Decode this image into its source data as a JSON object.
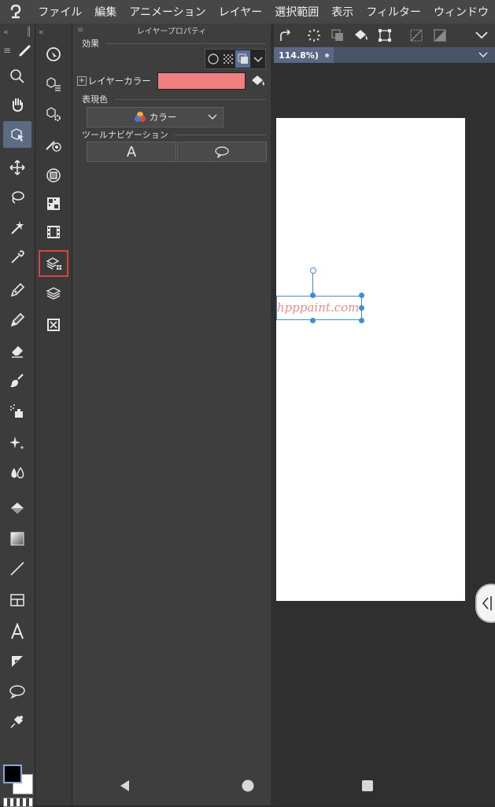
{
  "menu": {
    "items": [
      "ファイル",
      "編集",
      "アニメーション",
      "レイヤー",
      "選択範囲",
      "表示",
      "フィルター",
      "ウィンドウ"
    ]
  },
  "tools": [
    {
      "name": "zoom-tool",
      "icon": "magnifier-icon"
    },
    {
      "name": "hand-tool",
      "icon": "hand-icon"
    },
    {
      "name": "object-tool",
      "icon": "object-select-icon",
      "active": true
    },
    {
      "name": "move-tool",
      "icon": "move-arrows-icon"
    },
    {
      "name": "lasso-tool",
      "icon": "lasso-icon"
    },
    {
      "name": "magic-wand-tool",
      "icon": "magic-wand-icon"
    },
    {
      "name": "eyedropper-tool",
      "icon": "eyedropper-icon"
    },
    {
      "name": "pen-tool",
      "icon": "pen-icon"
    },
    {
      "name": "pencil-tool",
      "icon": "pencil-icon"
    },
    {
      "name": "eraser-tool",
      "icon": "eraser-icon"
    },
    {
      "name": "brush-tool",
      "icon": "brush-icon"
    },
    {
      "name": "airbrush-tool",
      "icon": "airbrush-icon"
    },
    {
      "name": "decoration-tool",
      "icon": "sparkle-icon"
    },
    {
      "name": "blend-tool",
      "icon": "blend-drops-icon"
    },
    {
      "name": "fill-tool",
      "icon": "paint-bucket-icon"
    },
    {
      "name": "gradient-tool",
      "icon": "gradient-icon"
    },
    {
      "name": "line-tool",
      "icon": "line-icon"
    },
    {
      "name": "frame-tool",
      "icon": "frame-border-icon"
    },
    {
      "name": "text-tool",
      "icon": "text-icon"
    },
    {
      "name": "balloon-tool",
      "icon": "balloon-tail-icon"
    },
    {
      "name": "speech-tool",
      "icon": "speech-bubble-icon"
    },
    {
      "name": "correct-line-tool",
      "icon": "correct-line-icon"
    }
  ],
  "subtools": [
    {
      "name": "navigator",
      "icon": "navigator-icon"
    },
    {
      "name": "subtool-3d-list",
      "icon": "cube-list-icon"
    },
    {
      "name": "subtool-3d-settings",
      "icon": "cube-gear-icon"
    },
    {
      "name": "brush-size",
      "icon": "brush-size-icon"
    },
    {
      "name": "layer-palette",
      "icon": "layer-circle-icon"
    },
    {
      "name": "material",
      "icon": "material-grid-icon"
    },
    {
      "name": "timeline",
      "icon": "film-icon"
    },
    {
      "name": "layer-property",
      "icon": "layer-property-icon",
      "selected": true
    },
    {
      "name": "layers",
      "icon": "layers-stack-icon"
    },
    {
      "name": "layer-search",
      "icon": "layer-search-icon"
    }
  ],
  "panel": {
    "title": "レイヤープロパティ",
    "effect_label": "効果",
    "layer_color_label": "レイヤーカラー",
    "layer_color": "#f08080",
    "expression_label": "表現色",
    "expression_value": "カラー",
    "tool_nav_label": "ツールナビゲーション",
    "text_button_label": "A"
  },
  "canvas": {
    "zoom_text": "114.8%)",
    "text_object": "hpppaint.com",
    "text_color": "#ef8a8a"
  },
  "colors": {
    "accent": "#5a6f93",
    "selection": "#3e8fd8",
    "highlight_border": "#d9453d"
  }
}
